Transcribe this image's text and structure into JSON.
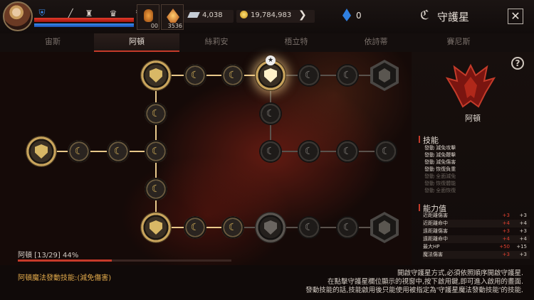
{
  "header": {
    "title": "守護星",
    "silver": "4,038",
    "gold": "19,784,983",
    "crystals": "0",
    "slot1_count": "00",
    "slot2_count": "3536"
  },
  "tabs": [
    {
      "label": "宙斯",
      "active": false
    },
    {
      "label": "阿頓",
      "active": true
    },
    {
      "label": "絲莉安",
      "active": false
    },
    {
      "label": "梧立特",
      "active": false
    },
    {
      "label": "依詩蒂",
      "active": false
    },
    {
      "label": "賽尼斯",
      "active": false
    }
  ],
  "progress": {
    "label": "阿頓 [13/29] 44%",
    "fraction": 0.44
  },
  "side": {
    "guardian_name": "阿頓",
    "skills_title": "技能",
    "skills": [
      {
        "text": "發動 減免攻擊",
        "active": true
      },
      {
        "text": "發動 減免鞭擊",
        "active": true
      },
      {
        "text": "發動 減免傷害",
        "active": true
      },
      {
        "text": "發動 恢復負重",
        "active": true
      },
      {
        "text": "發動 全面減免",
        "active": false
      },
      {
        "text": "發動 恢復體能",
        "active": false
      },
      {
        "text": "發動 全面恢復",
        "active": false
      }
    ],
    "stats_title": "能力值",
    "stats": [
      {
        "name": "近距離傷害",
        "current": "+3",
        "next": "+3"
      },
      {
        "name": "近距離命中",
        "current": "+4",
        "next": "+4"
      },
      {
        "name": "遠距離傷害",
        "current": "+3",
        "next": "+3"
      },
      {
        "name": "遠距離命中",
        "current": "+4",
        "next": "+4"
      },
      {
        "name": "最大HP",
        "current": "+50",
        "next": "+15"
      },
      {
        "name": "魔法傷害",
        "current": "+3",
        "next": "+3"
      }
    ]
  },
  "footer": {
    "active_skill": "阿頓魔法發動技能:(減免傷害)",
    "info_lines": [
      "開啟守護星方式,必須依照順序開啟守護星.",
      "在點擊守護星欄位顯示的視窗中,按下啟用鍵,即可進入啟用的畫面.",
      "發動技能的話,技能啟用後只能使用被指定為'守護星魔法發動技能'的技能."
    ]
  },
  "colors": {
    "accent_red": "#c43b2a",
    "gold": "#d9b45a",
    "line_lit": "#e8c88a",
    "line_unlit": "#5a524c"
  }
}
